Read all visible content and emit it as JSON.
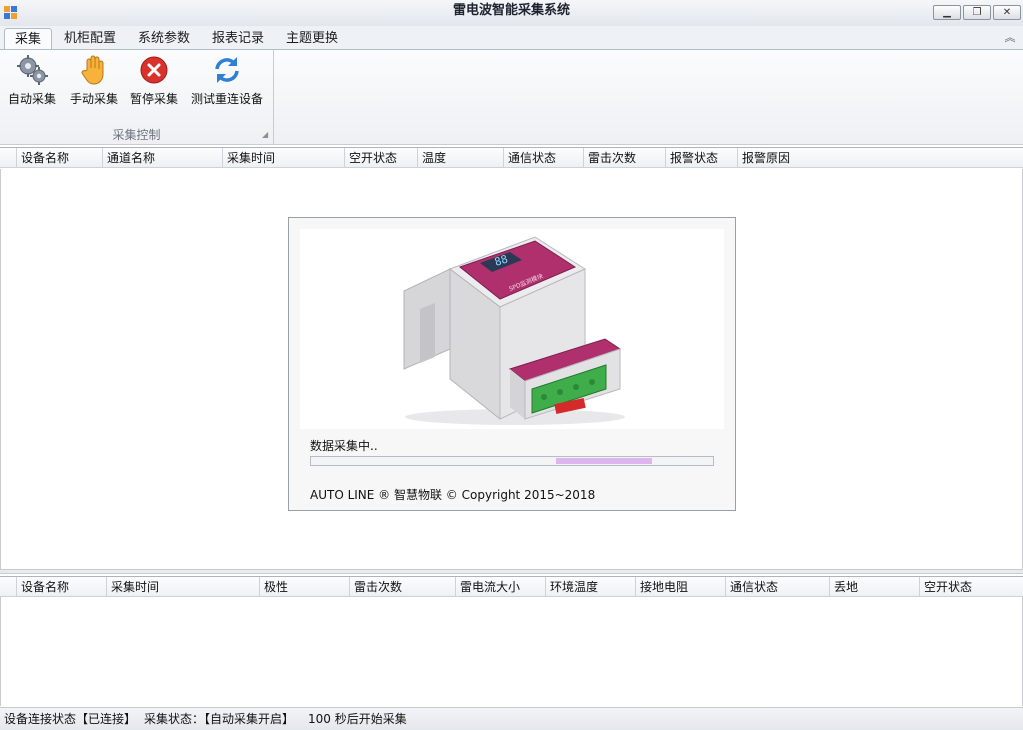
{
  "window": {
    "title": "雷电波智能采集系统",
    "minimize": "▁",
    "restore": "❐",
    "close": "✕"
  },
  "tabs": [
    "采集",
    "机柜配置",
    "系统参数",
    "报表记录",
    "主题更换"
  ],
  "ribbon": {
    "collapse_glyph": "︽",
    "group_label": "采集控制",
    "launcher_glyph": "◢",
    "buttons": [
      {
        "label": "自动采集",
        "icon": "gears-icon"
      },
      {
        "label": "手动采集",
        "icon": "hand-icon"
      },
      {
        "label": "暂停采集",
        "icon": "stop-icon"
      },
      {
        "label": "测试重连设备",
        "icon": "refresh-icon"
      }
    ]
  },
  "grid_top": {
    "columns": [
      "设备名称",
      "通道名称",
      "采集时间",
      "空开状态",
      "温度",
      "通信状态",
      "雷击次数",
      "报警状态",
      "报警原因"
    ]
  },
  "grid_bottom": {
    "columns": [
      "设备名称",
      "采集时间",
      "极性",
      "雷击次数",
      "雷电流大小",
      "环境温度",
      "接地电阻",
      "通信状态",
      "丢地",
      "空开状态"
    ]
  },
  "splash": {
    "loading_text": "数据采集中..",
    "progress": {
      "start": 0.61,
      "end": 0.85
    },
    "copyright": "AUTO LINE ® 智慧物联   © Copyright 2015~2018",
    "device_labels": {
      "display": "88",
      "caption": "SPD监测模块"
    }
  },
  "status": {
    "connection": "设备连接状态【已连接】",
    "acquisition": "采集状态：【自动采集开启】",
    "countdown": "100 秒后开始采集"
  },
  "colors": {
    "device_magenta": "#b0306e",
    "device_body": "#e6e6e8",
    "terminal_green": "#3fae4a",
    "progress_fill": "#dfb5f0"
  }
}
